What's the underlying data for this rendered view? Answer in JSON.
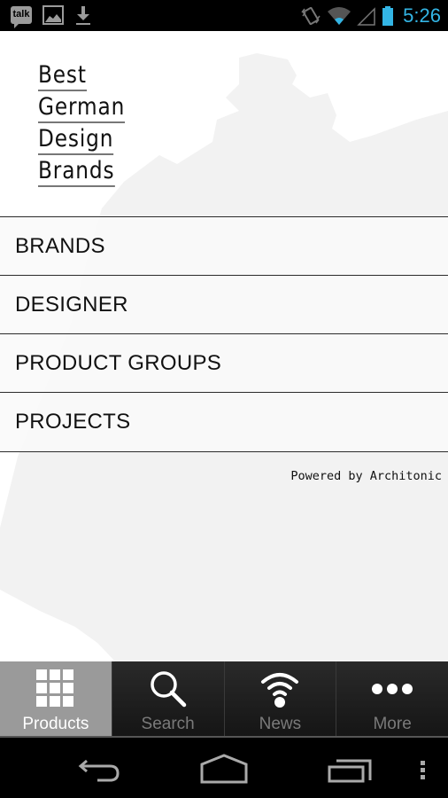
{
  "status_bar": {
    "time": "5:26",
    "notification_icons": [
      "talk-icon",
      "gallery-icon",
      "download-icon"
    ],
    "system_icons": [
      "vibrate-icon",
      "wifi-icon",
      "signal-icon",
      "battery-icon"
    ],
    "talk_label": "talk",
    "accent_color": "#33b5e5"
  },
  "logo": {
    "lines": [
      "Best",
      "German",
      "Design",
      "Brands"
    ]
  },
  "menu": {
    "items": [
      {
        "label": "BRANDS"
      },
      {
        "label": "DESIGNER"
      },
      {
        "label": "PRODUCT GROUPS"
      },
      {
        "label": "PROJECTS"
      }
    ]
  },
  "footer": {
    "powered_by": "Powered by Architonic"
  },
  "tabs": [
    {
      "label": "Products",
      "icon": "grid-icon",
      "active": true
    },
    {
      "label": "Search",
      "icon": "search-icon",
      "active": false
    },
    {
      "label": "News",
      "icon": "wifi-icon",
      "active": false
    },
    {
      "label": "More",
      "icon": "more-icon",
      "active": false
    }
  ],
  "nav_bar": {
    "buttons": [
      "back-icon",
      "home-icon",
      "recent-apps-icon",
      "menu-icon"
    ]
  }
}
